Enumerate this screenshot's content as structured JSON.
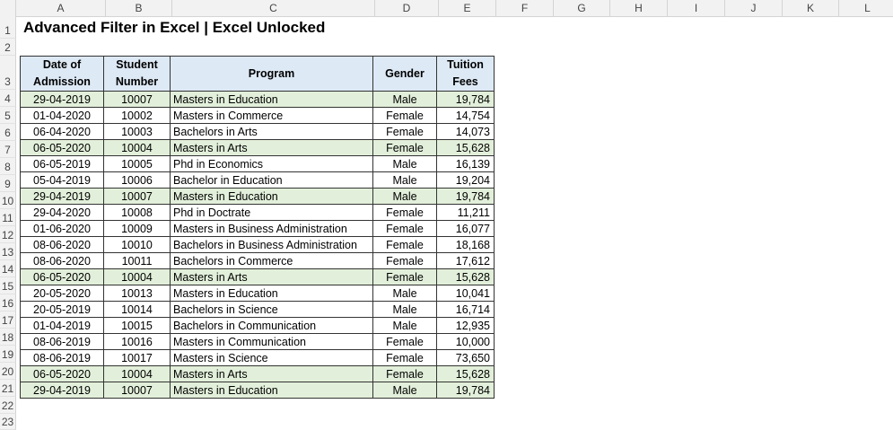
{
  "columns": [
    "A",
    "B",
    "C",
    "D",
    "E",
    "F",
    "G",
    "H",
    "I",
    "J",
    "K",
    "L"
  ],
  "rows": [
    "1",
    "2",
    "3",
    "4",
    "5",
    "6",
    "7",
    "8",
    "9",
    "10",
    "11",
    "12",
    "13",
    "14",
    "15",
    "16",
    "17",
    "18",
    "19",
    "20",
    "21",
    "22",
    "23"
  ],
  "title": "Advanced Filter in Excel | Excel Unlocked",
  "headers": {
    "date": [
      "Date of",
      "Admission"
    ],
    "student": [
      "Student",
      "Number"
    ],
    "program": "Program",
    "gender": "Gender",
    "fees": [
      "Tuition",
      "Fees"
    ]
  },
  "highlight_color": "#e2efda",
  "header_color": "#dde9f5",
  "records": [
    {
      "date": "29-04-2019",
      "num": "10007",
      "program": "Masters in Education",
      "gender": "Male",
      "fees": "19,784",
      "hl": true
    },
    {
      "date": "01-04-2020",
      "num": "10002",
      "program": "Masters in Commerce",
      "gender": "Female",
      "fees": "14,754",
      "hl": false
    },
    {
      "date": "06-04-2020",
      "num": "10003",
      "program": "Bachelors in Arts",
      "gender": "Female",
      "fees": "14,073",
      "hl": false
    },
    {
      "date": "06-05-2020",
      "num": "10004",
      "program": "Masters in Arts",
      "gender": "Female",
      "fees": "15,628",
      "hl": true
    },
    {
      "date": "06-05-2019",
      "num": "10005",
      "program": "Phd in Economics",
      "gender": "Male",
      "fees": "16,139",
      "hl": false
    },
    {
      "date": "05-04-2019",
      "num": "10006",
      "program": "Bachelor in Education",
      "gender": "Male",
      "fees": "19,204",
      "hl": false
    },
    {
      "date": "29-04-2019",
      "num": "10007",
      "program": "Masters in Education",
      "gender": "Male",
      "fees": "19,784",
      "hl": true
    },
    {
      "date": "29-04-2020",
      "num": "10008",
      "program": "Phd in Doctrate",
      "gender": "Female",
      "fees": "11,211",
      "hl": false
    },
    {
      "date": "01-06-2020",
      "num": "10009",
      "program": "Masters in Business Administration",
      "gender": "Female",
      "fees": "16,077",
      "hl": false
    },
    {
      "date": "08-06-2020",
      "num": "10010",
      "program": "Bachelors in Business Administration",
      "gender": "Female",
      "fees": "18,168",
      "hl": false
    },
    {
      "date": "08-06-2020",
      "num": "10011",
      "program": "Bachelors in Commerce",
      "gender": "Female",
      "fees": "17,612",
      "hl": false
    },
    {
      "date": "06-05-2020",
      "num": "10004",
      "program": "Masters in Arts",
      "gender": "Female",
      "fees": "15,628",
      "hl": true
    },
    {
      "date": "20-05-2020",
      "num": "10013",
      "program": "Masters in Education",
      "gender": "Male",
      "fees": "10,041",
      "hl": false
    },
    {
      "date": "20-05-2019",
      "num": "10014",
      "program": "Bachelors in Science",
      "gender": "Male",
      "fees": "16,714",
      "hl": false
    },
    {
      "date": "01-04-2019",
      "num": "10015",
      "program": "Bachelors in Communication",
      "gender": "Male",
      "fees": "12,935",
      "hl": false
    },
    {
      "date": "08-06-2019",
      "num": "10016",
      "program": "Masters in Communication",
      "gender": "Female",
      "fees": "10,000",
      "hl": false
    },
    {
      "date": "08-06-2019",
      "num": "10017",
      "program": "Masters in Science",
      "gender": "Female",
      "fees": "73,650",
      "hl": false
    },
    {
      "date": "06-05-2020",
      "num": "10004",
      "program": "Masters in Arts",
      "gender": "Female",
      "fees": "15,628",
      "hl": true
    },
    {
      "date": "29-04-2019",
      "num": "10007",
      "program": "Masters in Education",
      "gender": "Male",
      "fees": "19,784",
      "hl": true
    }
  ]
}
